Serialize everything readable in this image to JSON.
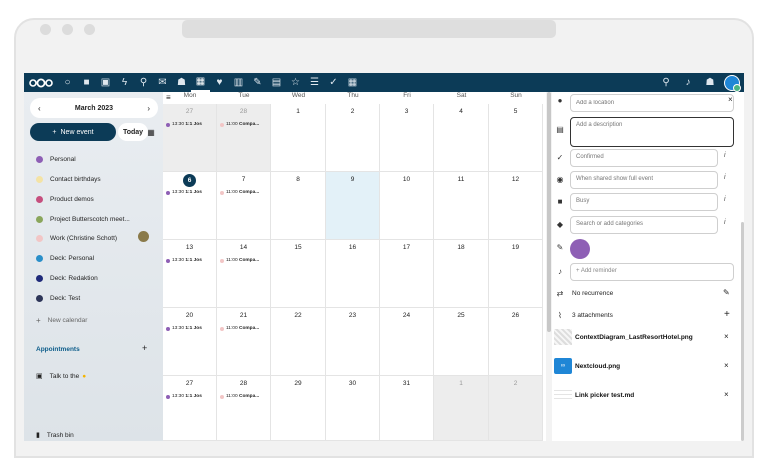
{
  "nav": {
    "apps": [
      "dashboard-icon",
      "files-icon",
      "photos-icon",
      "activity-icon",
      "search-icon",
      "mail-icon",
      "contacts-icon",
      "calendar-icon",
      "favorites-icon",
      "analytics-icon",
      "notes-icon",
      "deck-icon",
      "stars-icon",
      "tasks-icon",
      "checklist-icon",
      "tables-icon"
    ],
    "right": [
      "search-icon",
      "notifications-icon",
      "contacts-menu-icon",
      "user-avatar"
    ]
  },
  "sidebar": {
    "month": "March 2023",
    "new_event": "New event",
    "today": "Today",
    "calendars": [
      {
        "label": "Personal",
        "color": "#8e5fb5"
      },
      {
        "label": "Contact birthdays",
        "color": "#f4e3a5"
      },
      {
        "label": "Product demos",
        "color": "#c64f7e"
      },
      {
        "label": "Project Butterscotch meet...",
        "color": "#8aa65c"
      },
      {
        "label": "Work (Christine Schott)",
        "color": "#f2c6c6"
      },
      {
        "label": "Deck: Personal",
        "color": "#2a8fc9"
      },
      {
        "label": "Deck: Redaktion",
        "color": "#1f2a7a"
      },
      {
        "label": "Deck: Test",
        "color": "#2d3558"
      }
    ],
    "new_calendar": "New calendar",
    "appointments": "Appointments",
    "talk_to": "Talk to the",
    "trash": "Trash bin"
  },
  "calendar": {
    "days": [
      "Mon",
      "Tue",
      "Wed",
      "Thu",
      "Fri",
      "Sat",
      "Sun"
    ],
    "weeks": [
      [
        "27",
        "28",
        "1",
        "2",
        "3",
        "4",
        "5"
      ],
      [
        "6",
        "7",
        "8",
        "9",
        "10",
        "11",
        "12"
      ],
      [
        "13",
        "14",
        "15",
        "16",
        "17",
        "18",
        "19"
      ],
      [
        "20",
        "21",
        "22",
        "23",
        "24",
        "25",
        "26"
      ],
      [
        "27",
        "28",
        "29",
        "30",
        "31",
        "1",
        "2"
      ]
    ],
    "event_mon_time": "13:30",
    "event_mon_title": "1:1 Jos",
    "event_tue_time": "11:00",
    "event_tue_title": "Compa..."
  },
  "panel": {
    "location_placeholder": "Add a location",
    "description_placeholder": "Add a description",
    "status": "Confirmed",
    "visibility": "When shared show full event",
    "availability": "Busy",
    "categories_placeholder": "Search or add categories",
    "reminder": "+ Add reminder",
    "recurrence": "No recurrence",
    "attachments_label": "3 attachments",
    "attachments": [
      "ContextDiagram_LastResortHotel.png",
      "Nextcloud.png",
      "Link picker test.md"
    ],
    "info_glyph": "i"
  }
}
